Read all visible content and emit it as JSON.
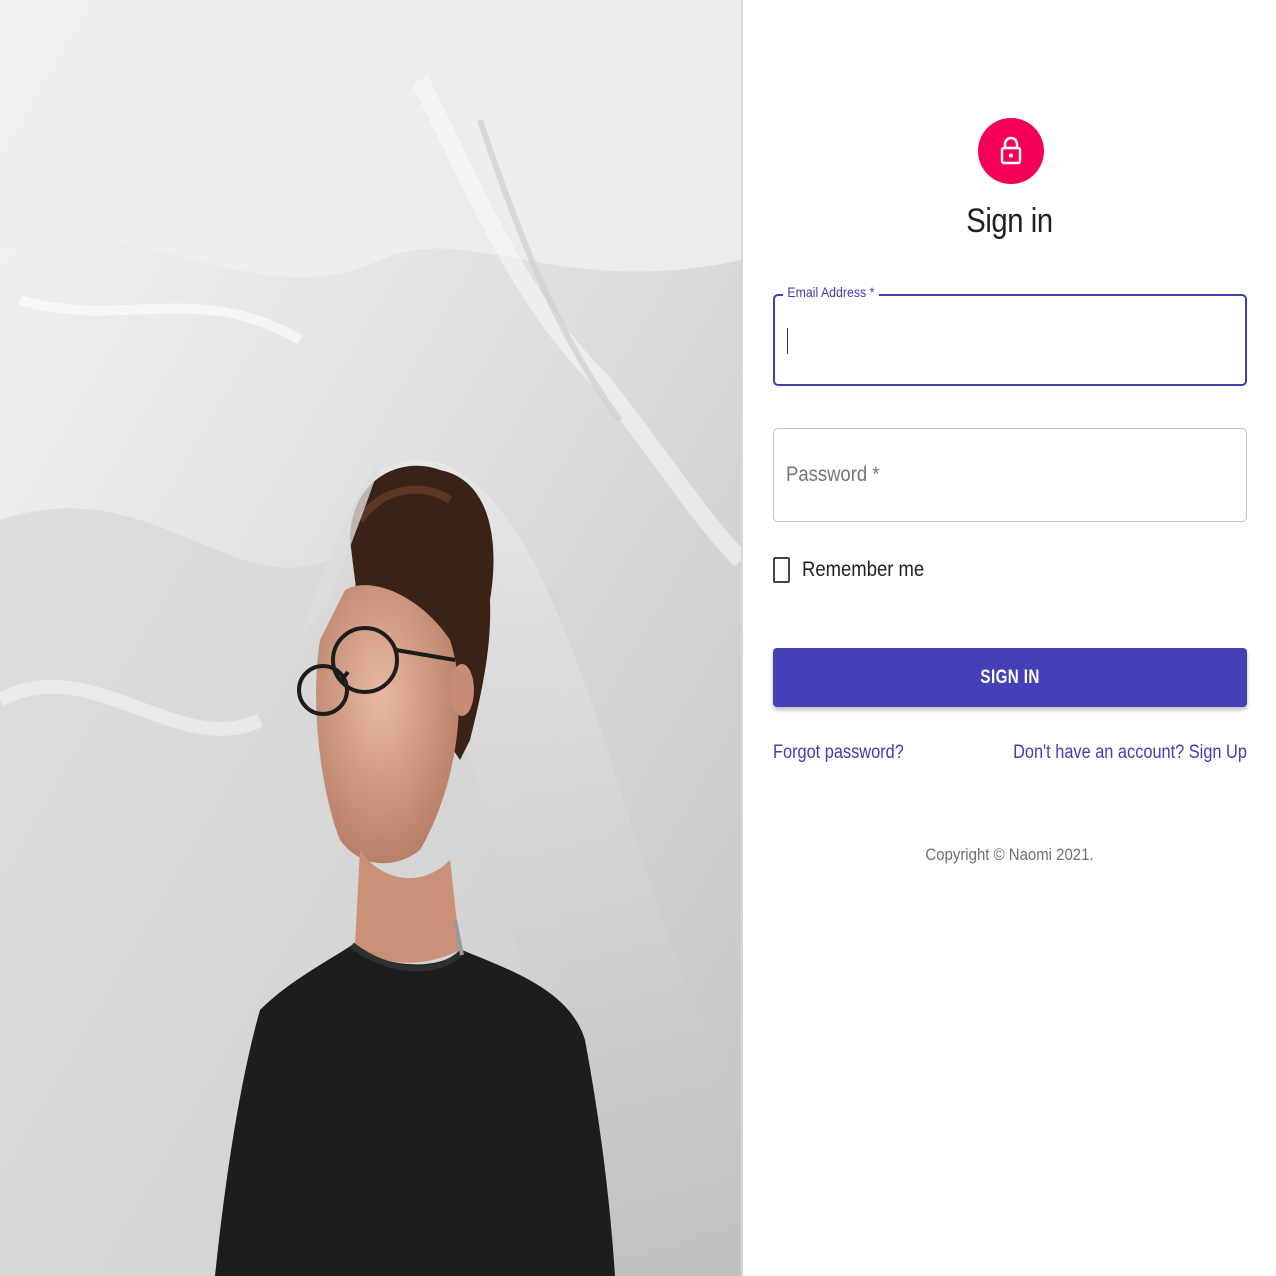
{
  "photo": {
    "icon": "person-under-plastic-sheet-photo"
  },
  "header": {
    "icon": "lock-icon",
    "title": "Sign in"
  },
  "form": {
    "email": {
      "label": "Email Address *",
      "value": ""
    },
    "password": {
      "label": "Password *",
      "value": ""
    },
    "remember": {
      "label": "Remember me",
      "checked": false
    },
    "submit_label": "SIGN IN"
  },
  "links": {
    "forgot": "Forgot password?",
    "signup": "Don't have an account? Sign Up"
  },
  "footer": {
    "copyright": "Copyright © Naomi 2021."
  },
  "colors": {
    "primary": "#3f3db5",
    "button": "#4540b7",
    "avatar": "#f50057",
    "text": "#212121",
    "muted": "#6f6f6f"
  }
}
